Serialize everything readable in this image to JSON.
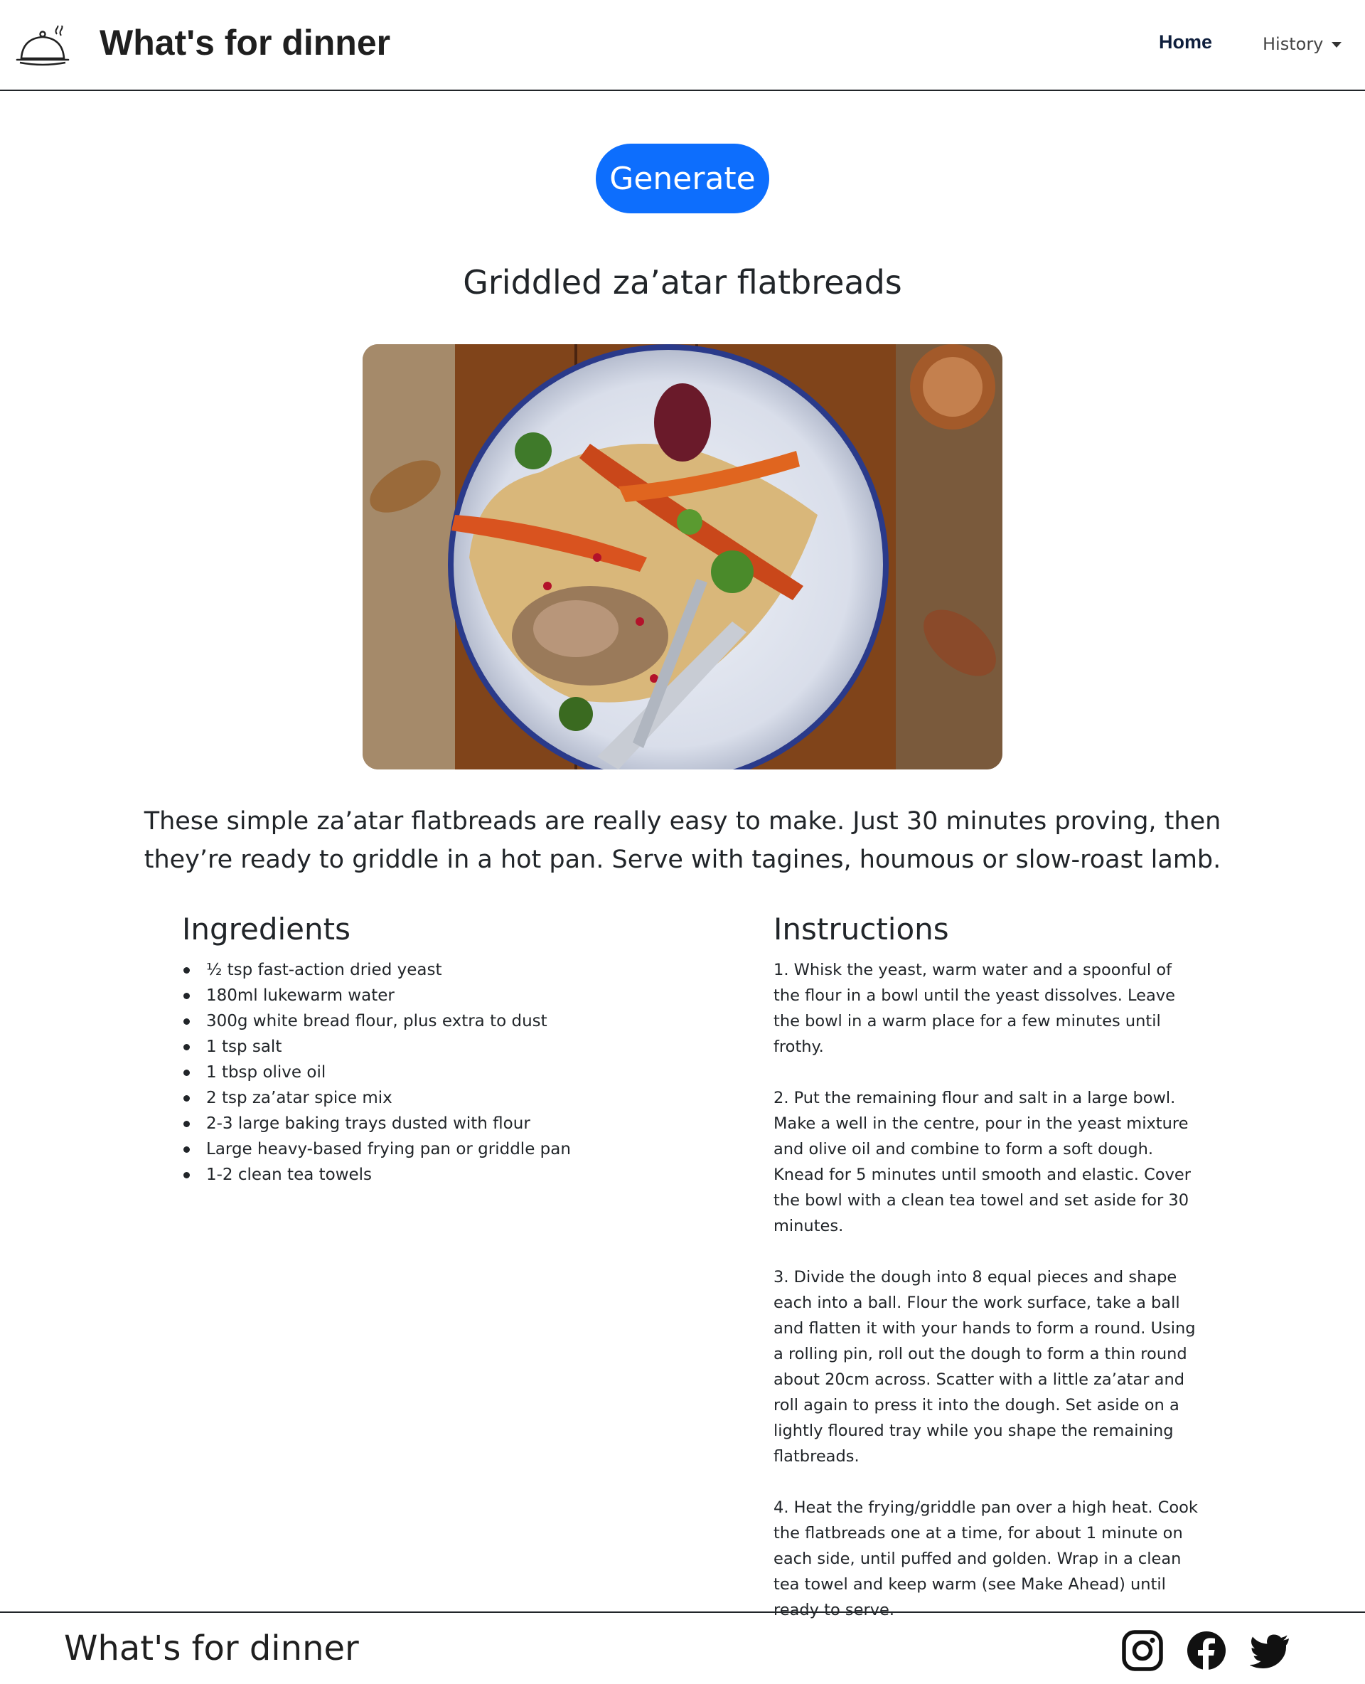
{
  "navbar": {
    "brand": "What's for dinner",
    "logo_icon": "serving-cloche-icon",
    "home_label": "Home",
    "history_label": "History"
  },
  "generate_label": "Generate",
  "recipe": {
    "title": "Griddled za’atar flatbreads",
    "image_alt": "Griddled za’atar flatbreads",
    "description": "These simple za’atar flatbreads are really easy to make. Just 30 minutes proving, then they’re ready to griddle in a hot pan. Serve with tagines, houmous or slow-roast lamb.",
    "ingredients_heading": "Ingredients",
    "ingredients": [
      "½ tsp fast-action dried yeast",
      "180ml lukewarm water",
      "300g white bread flour, plus extra to dust",
      "1 tsp salt",
      "1 tbsp olive oil",
      "2 tsp za’atar spice mix",
      "2-3 large baking trays dusted with flour",
      "Large heavy-based frying pan or griddle pan",
      "1-2 clean tea towels"
    ],
    "instructions_heading": "Instructions",
    "instructions": [
      "1. Whisk the yeast, warm water and a spoonful of the flour in a bowl until the yeast dissolves. Leave the bowl in a warm place for a few minutes until frothy.",
      "2. Put the remaining flour and salt in a large bowl. Make a well in the centre, pour in the yeast mixture and olive oil and combine to form a soft dough. Knead for 5 minutes until smooth and elastic. Cover the bowl with a clean tea towel and set aside for 30 minutes.",
      "3. Divide the dough into 8 equal pieces and shape each into a ball. Flour the work surface, take a ball and flatten it with your hands to form a round. Using a rolling pin, roll out the dough to form a thin round about 20cm across. Scatter with a little za’atar and roll again to press it into the dough. Set aside on a lightly floured tray while you shape the remaining flatbreads.",
      "4. Heat the frying/griddle pan over a high heat. Cook the flatbreads one at a time, for about 1 minute on each side, until puffed and golden. Wrap in a clean tea towel and keep warm (see Make Ahead) until ready to serve."
    ]
  },
  "footer": {
    "brand": "What's for dinner",
    "social_icons": [
      "instagram-icon",
      "facebook-icon",
      "twitter-icon"
    ]
  },
  "colors": {
    "accent": "#0d6efd",
    "text": "#212529",
    "nav_active": "#0f1f3d"
  }
}
